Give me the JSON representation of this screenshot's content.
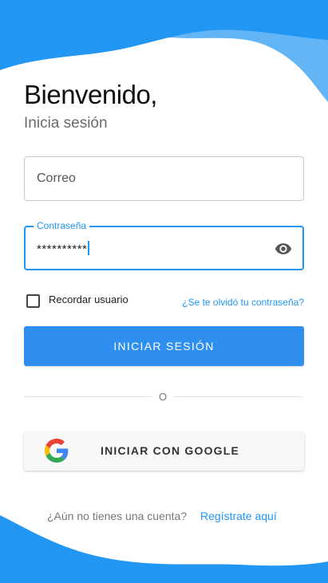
{
  "header": {
    "title": "Bienvenido,",
    "subtitle": "Inicia sesión"
  },
  "form": {
    "email_placeholder": "Correo",
    "password_label": "Contraseña",
    "password_value": "**********",
    "password_visibility_icon": "eye-icon",
    "remember_label": "Recordar usuario",
    "remember_checked": false,
    "forgot_link": "¿Se te olvidó tu contraseña?",
    "login_button": "INICIAR SESIÓN"
  },
  "separator": {
    "label": "O"
  },
  "google": {
    "icon": "google-logo-icon",
    "button_label": "INICIAR CON GOOGLE"
  },
  "footer": {
    "no_account_text": "¿Aún no tienes una cuenta?",
    "register_link": "Regístrate aquí"
  },
  "colors": {
    "accent": "#2196F3",
    "wave_dark": "#2196F3",
    "wave_light": "#64B5F6",
    "button": "#2F8FEF"
  }
}
